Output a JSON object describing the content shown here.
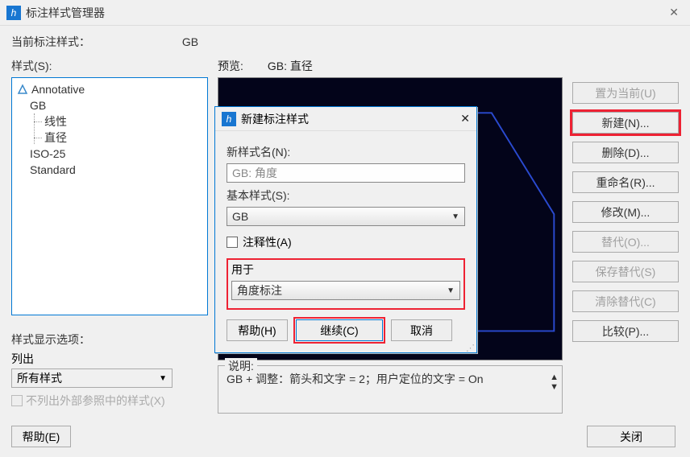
{
  "titlebar": {
    "title": "标注样式管理器",
    "close": "✕"
  },
  "current_label": "当前标注样式：",
  "current_value": "GB",
  "styles_label": "样式(S):",
  "tree": {
    "items": [
      {
        "name": "Annotative",
        "icon": true
      },
      {
        "name": "GB",
        "children": [
          "线性",
          "直径"
        ]
      },
      {
        "name": "ISO-25"
      },
      {
        "name": "Standard"
      }
    ]
  },
  "display_opts": {
    "title": "样式显示选项：",
    "list_label": "列出",
    "select_value": "所有样式",
    "checkbox_label": "不列出外部参照中的样式(X)"
  },
  "preview": {
    "label": "预览:",
    "subtitle": "GB: 直径"
  },
  "desc": {
    "legend": "说明:",
    "text": "GB + 调整：箭头和文字 = 2；用户定位的文字 = On"
  },
  "buttons": {
    "set_current": "置为当前(U)",
    "new": "新建(N)...",
    "delete": "删除(D)...",
    "rename": "重命名(R)...",
    "modify": "修改(M)...",
    "override": "替代(O)...",
    "save_override": "保存替代(S)",
    "clear_override": "清除替代(C)",
    "compare": "比较(P)...",
    "help": "帮助(E)",
    "close": "关闭"
  },
  "dialog": {
    "title": "新建标注样式",
    "close": "✕",
    "new_name_label": "新样式名(N):",
    "new_name_value": "GB: 角度",
    "base_style_label": "基本样式(S):",
    "base_style_value": "GB",
    "annot_label": "注释性(A)",
    "use_for_label": "用于",
    "use_for_value": "角度标注",
    "help": "帮助(H)",
    "continue": "继续(C)",
    "cancel": "取消"
  }
}
